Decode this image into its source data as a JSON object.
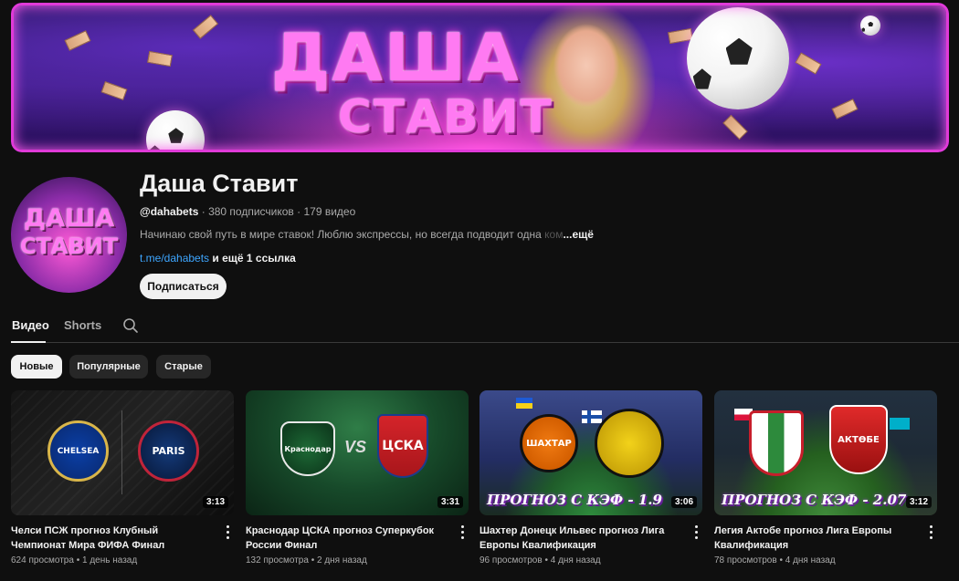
{
  "banner": {
    "line1": "ДАША",
    "line2": "СТАВИТ"
  },
  "avatar": {
    "line1": "ДАША",
    "line2": "СТАВИТ"
  },
  "channel": {
    "name": "Даша Ставит",
    "handle": "@dahabets",
    "subscribers": "380 подписчиков",
    "videos_count": "179 видео",
    "separator": " · ",
    "description": "Начинаю свой путь в мире ставок! Люблю экспрессы, но всегда подводит одна ",
    "description_fade": "ком",
    "description_more": "...ещё",
    "link": "t.me/dahabets",
    "link_extra": " и ещё 1 ссылка",
    "subscribe_label": "Подписаться"
  },
  "tabs": [
    {
      "label": "Видео",
      "active": true
    },
    {
      "label": "Shorts",
      "active": false
    }
  ],
  "chips": [
    {
      "label": "Новые",
      "active": true
    },
    {
      "label": "Популярные",
      "active": false
    },
    {
      "label": "Старые",
      "active": false
    }
  ],
  "videos": [
    {
      "title": "Челси ПСЖ прогноз Клубный Чемпионат Мира ФИФА Финал",
      "views": "624 просмотра",
      "age": "1 день назад",
      "duration": "3:13",
      "thumb_left": "CHELSEA",
      "thumb_right": "PARIS"
    },
    {
      "title": "Краснодар ЦСКА прогноз Суперкубок России Финал",
      "views": "132 просмотра",
      "age": "2 дня назад",
      "duration": "3:31",
      "thumb_left": "Краснодар",
      "thumb_vs": "VS",
      "thumb_right": "ЦСКА"
    },
    {
      "title": "Шахтер Донецк Ильвес прогноз Лига Европы Квалификация",
      "views": "96 просмотров",
      "age": "4 дня назад",
      "duration": "3:06",
      "thumb_left": "ШАХТАР",
      "thumb_overlay": "ПРОГНОЗ С КЭФ - 1.9"
    },
    {
      "title": "Легия Актобе прогноз Лига Европы Квалификация",
      "views": "78 просмотров",
      "age": "4 дня назад",
      "duration": "3:12",
      "thumb_right": "АКТӨБЕ",
      "thumb_overlay": "ПРОГНОЗ С КЭФ - 2.07"
    }
  ],
  "meta_separator": " • "
}
